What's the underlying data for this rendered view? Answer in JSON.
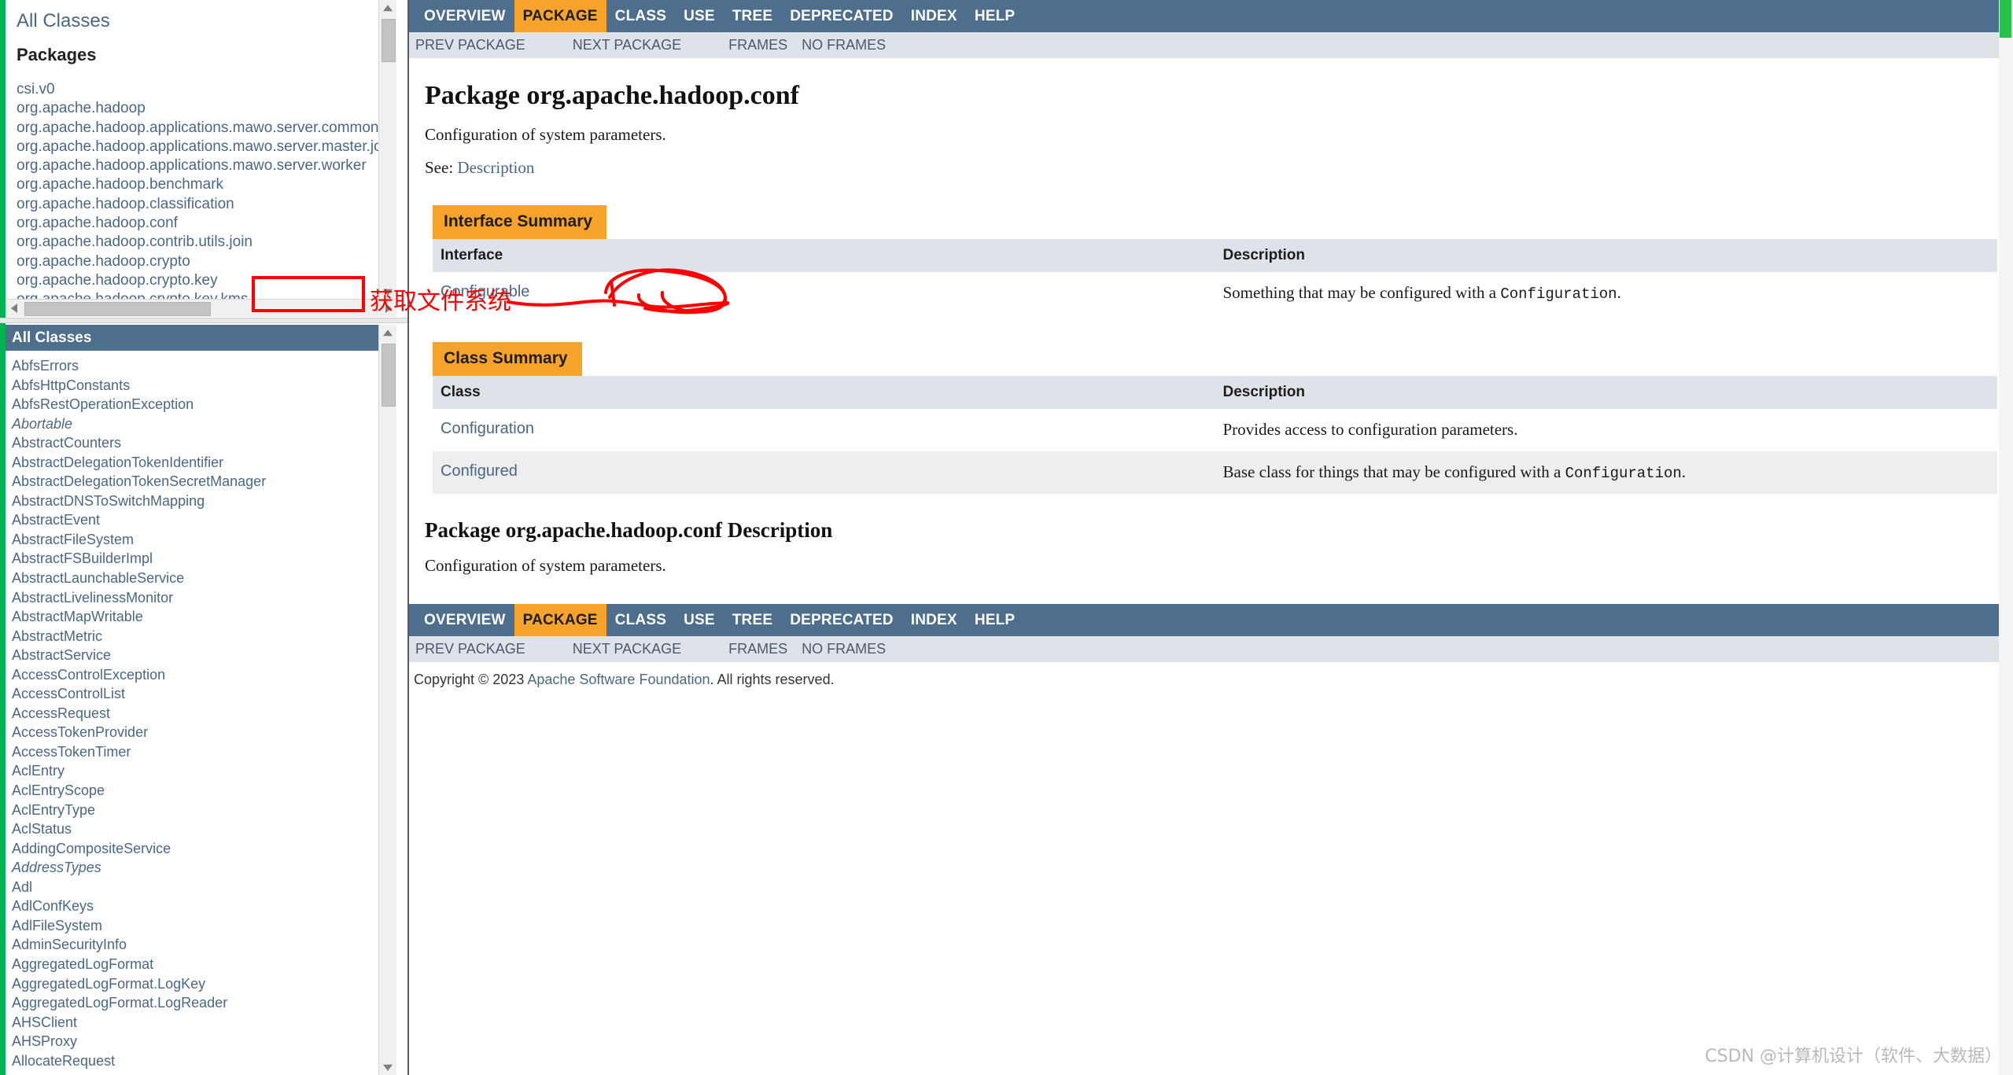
{
  "colors": {
    "nav_bg": "#4e6e8e",
    "nav_active": "#f6a32c",
    "caption_bg": "#f6a32c",
    "table_header_bg": "#dee3e9",
    "link": "#4a6785",
    "annotation_red": "#ff0000",
    "rail_green": "#00b451",
    "scroll_green": "#27c24c"
  },
  "packages_frame": {
    "all_classes_link": "All Classes",
    "heading": "Packages",
    "items": [
      "csi.v0",
      "org.apache.hadoop",
      "org.apache.hadoop.applications.mawo.server.common",
      "org.apache.hadoop.applications.mawo.server.master.job",
      "org.apache.hadoop.applications.mawo.server.worker",
      "org.apache.hadoop.benchmark",
      "org.apache.hadoop.classification",
      "org.apache.hadoop.conf",
      "org.apache.hadoop.contrib.utils.join",
      "org.apache.hadoop.crypto",
      "org.apache.hadoop.crypto.key",
      "org.apache.hadoop.crypto.key.kms"
    ]
  },
  "classes_frame": {
    "title": "All Classes",
    "items": [
      {
        "label": "AbfsErrors",
        "italic": false
      },
      {
        "label": "AbfsHttpConstants",
        "italic": false
      },
      {
        "label": "AbfsRestOperationException",
        "italic": false
      },
      {
        "label": "Abortable",
        "italic": true
      },
      {
        "label": "AbstractCounters",
        "italic": false
      },
      {
        "label": "AbstractDelegationTokenIdentifier",
        "italic": false
      },
      {
        "label": "AbstractDelegationTokenSecretManager",
        "italic": false
      },
      {
        "label": "AbstractDNSToSwitchMapping",
        "italic": false
      },
      {
        "label": "AbstractEvent",
        "italic": false
      },
      {
        "label": "AbstractFileSystem",
        "italic": false
      },
      {
        "label": "AbstractFSBuilderImpl",
        "italic": false
      },
      {
        "label": "AbstractLaunchableService",
        "italic": false
      },
      {
        "label": "AbstractLivelinessMonitor",
        "italic": false
      },
      {
        "label": "AbstractMapWritable",
        "italic": false
      },
      {
        "label": "AbstractMetric",
        "italic": false
      },
      {
        "label": "AbstractService",
        "italic": false
      },
      {
        "label": "AccessControlException",
        "italic": false
      },
      {
        "label": "AccessControlList",
        "italic": false
      },
      {
        "label": "AccessRequest",
        "italic": false
      },
      {
        "label": "AccessTokenProvider",
        "italic": false
      },
      {
        "label": "AccessTokenTimer",
        "italic": false
      },
      {
        "label": "AclEntry",
        "italic": false
      },
      {
        "label": "AclEntryScope",
        "italic": false
      },
      {
        "label": "AclEntryType",
        "italic": false
      },
      {
        "label": "AclStatus",
        "italic": false
      },
      {
        "label": "AddingCompositeService",
        "italic": false
      },
      {
        "label": "AddressTypes",
        "italic": true
      },
      {
        "label": "Adl",
        "italic": false
      },
      {
        "label": "AdlConfKeys",
        "italic": false
      },
      {
        "label": "AdlFileSystem",
        "italic": false
      },
      {
        "label": "AdminSecurityInfo",
        "italic": false
      },
      {
        "label": "AggregatedLogFormat",
        "italic": false
      },
      {
        "label": "AggregatedLogFormat.LogKey",
        "italic": false
      },
      {
        "label": "AggregatedLogFormat.LogReader",
        "italic": false
      },
      {
        "label": "AHSClient",
        "italic": false
      },
      {
        "label": "AHSProxy",
        "italic": false
      },
      {
        "label": "AllocateRequest",
        "italic": false
      }
    ]
  },
  "topnav": {
    "items": [
      {
        "label": "OVERVIEW",
        "active": false
      },
      {
        "label": "PACKAGE",
        "active": true
      },
      {
        "label": "CLASS",
        "active": false
      },
      {
        "label": "USE",
        "active": false
      },
      {
        "label": "TREE",
        "active": false
      },
      {
        "label": "DEPRECATED",
        "active": false
      },
      {
        "label": "INDEX",
        "active": false
      },
      {
        "label": "HELP",
        "active": false
      }
    ]
  },
  "subnav": {
    "prev_package": "PREV PACKAGE",
    "next_package": "NEXT PACKAGE",
    "frames": "FRAMES",
    "no_frames": "NO FRAMES"
  },
  "main": {
    "page_title": "Package org.apache.hadoop.conf",
    "intro": "Configuration of system parameters.",
    "see_label": "See:",
    "see_link": "Description",
    "interface_summary": {
      "caption": "Interface Summary",
      "col_interface": "Interface",
      "col_description": "Description",
      "rows": [
        {
          "name": "Configurable",
          "desc_before": "Something that may be configured with a ",
          "desc_code": "Configuration",
          "desc_after": "."
        }
      ]
    },
    "class_summary": {
      "caption": "Class Summary",
      "col_class": "Class",
      "col_description": "Description",
      "rows": [
        {
          "name": "Configuration",
          "desc_before": "Provides access to configuration parameters.",
          "desc_code": "",
          "desc_after": ""
        },
        {
          "name": "Configured",
          "desc_before": "Base class for things that may be configured with a ",
          "desc_code": "Configuration",
          "desc_after": "."
        }
      ]
    },
    "description_heading": "Package org.apache.hadoop.conf Description",
    "description_body": "Configuration of system parameters."
  },
  "footer": {
    "copyright_prefix": "Copyright © 2023 ",
    "copyright_link": "Apache Software Foundation",
    "copyright_suffix": ". All rights reserved."
  },
  "annotations": {
    "chinese_note": "获取文件系统"
  },
  "watermark": {
    "text": "CSDN @计算机设计（软件、大数据）"
  }
}
